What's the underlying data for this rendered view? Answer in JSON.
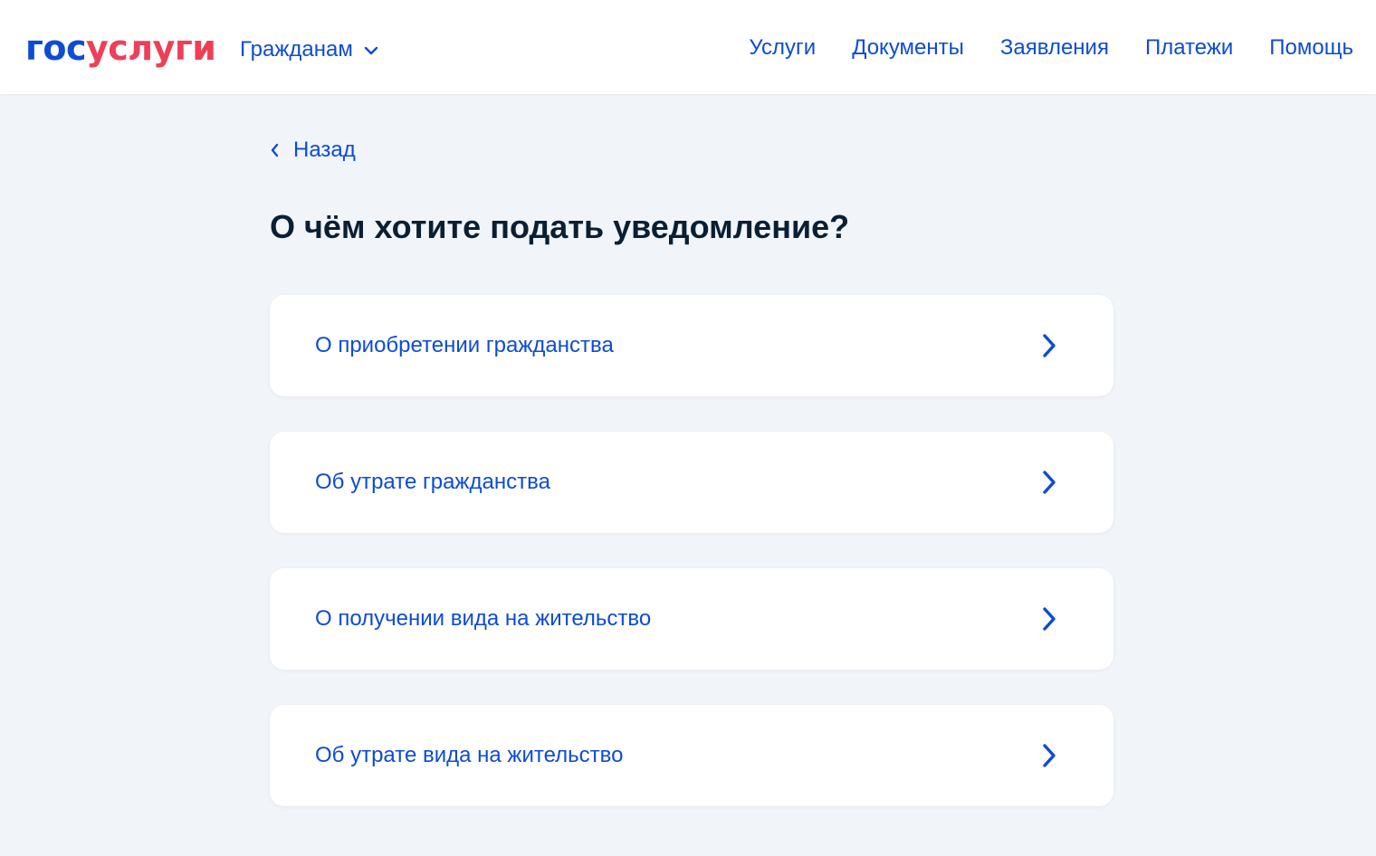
{
  "header": {
    "logo": {
      "part_a": "гос",
      "part_b": "услуги"
    },
    "audience_selector": {
      "label": "Гражданам",
      "icon": "chevron-down-icon"
    },
    "nav": [
      {
        "label": "Услуги"
      },
      {
        "label": "Документы"
      },
      {
        "label": "Заявления"
      },
      {
        "label": "Платежи"
      },
      {
        "label": "Помощь"
      }
    ]
  },
  "main": {
    "back_link": {
      "label": "Назад",
      "icon": "chevron-left-icon"
    },
    "title": "О чём хотите подать уведомление?",
    "options": [
      {
        "label": "О приобретении гражданства",
        "icon": "chevron-right-icon"
      },
      {
        "label": "Об утрате гражданства",
        "icon": "chevron-right-icon"
      },
      {
        "label": "О получении вида на жительство",
        "icon": "chevron-right-icon"
      },
      {
        "label": "Об утрате вида на жительство",
        "icon": "chevron-right-icon"
      }
    ]
  },
  "colors": {
    "accent_blue": "#0d4cd3",
    "brand_red": "#ee3f58",
    "page_background": "#f1f4f9",
    "text_dark": "#0b1f33",
    "card_background": "#ffffff"
  }
}
